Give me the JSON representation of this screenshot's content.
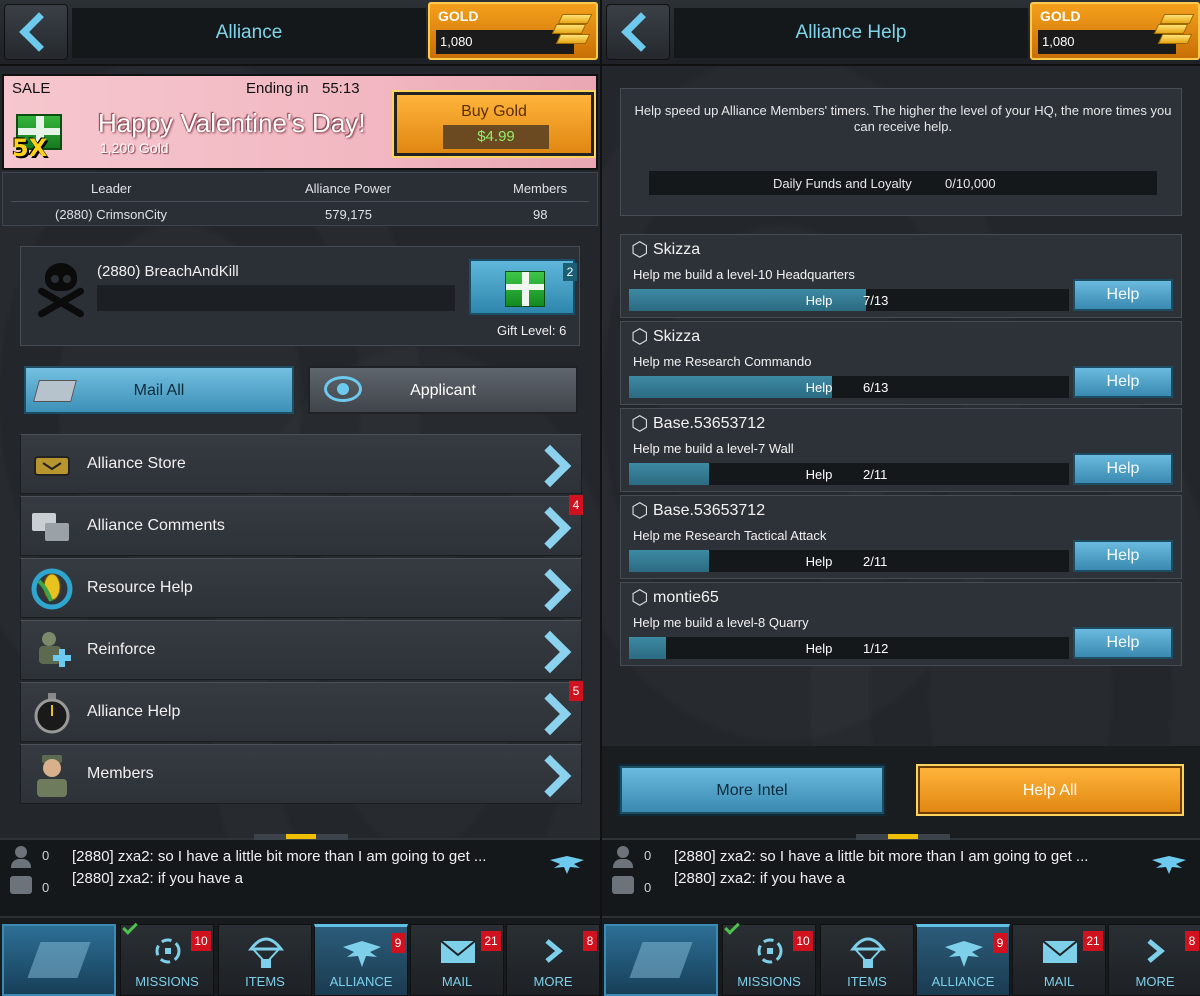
{
  "left": {
    "header": {
      "title": "Alliance",
      "gold_label": "GOLD",
      "gold_value": "1,080"
    },
    "sale": {
      "label": "SALE",
      "ending_label": "Ending in",
      "timer": "55:13",
      "title": "Happy Valentine's Day!",
      "subtitle": "1,200 Gold",
      "multiplier": "5X",
      "buy_label": "Buy Gold",
      "price": "$4.99"
    },
    "stats": {
      "leader_label": "Leader",
      "leader_value": "(2880) CrimsonCity",
      "power_label": "Alliance Power",
      "power_value": "579,175",
      "members_label": "Members",
      "members_value": "98"
    },
    "member": {
      "name": "(2880) BreachAndKill",
      "gift_count": "2",
      "gift_level": "Gift Level: 6"
    },
    "buttons": {
      "mail_all": "Mail All",
      "applicant": "Applicant"
    },
    "menu": [
      {
        "label": "Alliance Store",
        "badge": "",
        "icon": "alliance-store-icon"
      },
      {
        "label": "Alliance Comments",
        "badge": "4",
        "icon": "comments-icon"
      },
      {
        "label": "Resource Help",
        "badge": "",
        "icon": "resource-help-icon"
      },
      {
        "label": "Reinforce",
        "badge": "",
        "icon": "reinforce-icon"
      },
      {
        "label": "Alliance Help",
        "badge": "5",
        "icon": "stopwatch-icon"
      },
      {
        "label": "Members",
        "badge": "",
        "icon": "soldier-icon"
      }
    ]
  },
  "right": {
    "header": {
      "title": "Alliance Help",
      "gold_label": "GOLD",
      "gold_value": "1,080"
    },
    "info": {
      "text": "Help speed up Alliance Members' timers. The higher the level of your HQ, the more times you can receive help.",
      "funds_label": "Daily Funds and Loyalty",
      "funds_value": "0/10,000"
    },
    "requests": [
      {
        "name": "Skizza",
        "task": "Help me build a level-10 Headquarters",
        "bar_label": "Help",
        "count": "7/13",
        "progress": 0.538,
        "button": "Help"
      },
      {
        "name": "Skizza",
        "task": "Help me Research Commando",
        "bar_label": "Help",
        "count": "6/13",
        "progress": 0.462,
        "button": "Help"
      },
      {
        "name": "Base.53653712",
        "task": "Help me build a level-7 Wall",
        "bar_label": "Help",
        "count": "2/11",
        "progress": 0.182,
        "button": "Help"
      },
      {
        "name": "Base.53653712",
        "task": "Help me Research Tactical Attack",
        "bar_label": "Help",
        "count": "2/11",
        "progress": 0.182,
        "button": "Help"
      },
      {
        "name": "montie65",
        "task": "Help me build a level-8 Quarry",
        "bar_label": "Help",
        "count": "1/12",
        "progress": 0.083,
        "button": "Help"
      }
    ],
    "buttons": {
      "more_intel": "More Intel",
      "help_all": "Help All"
    }
  },
  "chat": {
    "user_count": "0",
    "msg_count": "0",
    "line1": "[2880] zxa2: so I have a little bit more than I am going to get ...",
    "line2": "[2880] zxa2: if you have a"
  },
  "nav": [
    {
      "label": "MISSIONS",
      "badge": "10",
      "icon": "crosshair-icon"
    },
    {
      "label": "ITEMS",
      "badge": "",
      "icon": "parachute-icon"
    },
    {
      "label": "ALLIANCE",
      "badge": "9",
      "icon": "eagle-icon"
    },
    {
      "label": "MAIL",
      "badge": "21",
      "icon": "envelope-icon"
    },
    {
      "label": "MORE",
      "badge": "8",
      "icon": "chevron-right-icon"
    }
  ],
  "colors": {
    "accent": "#7fd5ea",
    "gold": "#f5a01c",
    "badge": "#d0121e",
    "help_blue": "#3989b1"
  }
}
